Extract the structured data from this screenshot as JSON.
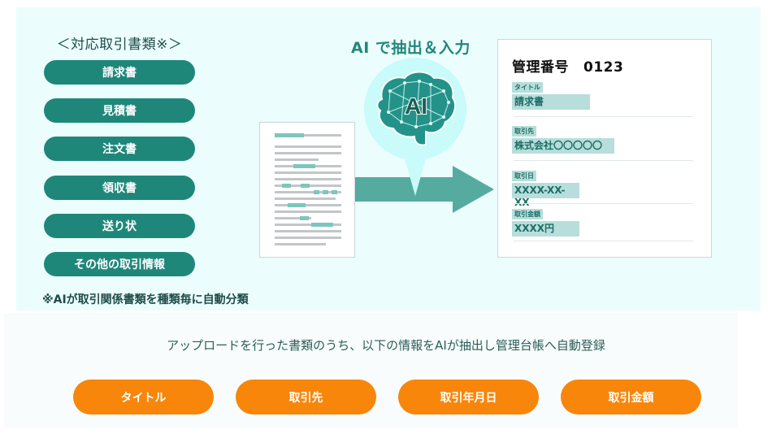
{
  "supported_types": {
    "heading": "＜対応取引書類※＞",
    "items": [
      "請求書",
      "見積書",
      "注文書",
      "領収書",
      "送り状",
      "その他の取引情報"
    ],
    "note": "※AIが取引関係書類を種類毎に自動分類"
  },
  "process": {
    "heading": "AI で抽出＆入力",
    "ai_badge_text": "AI",
    "icons": [
      "document-icon",
      "ai-brain-icon",
      "arrow-right-icon"
    ]
  },
  "record_card": {
    "title_label": "管理番号",
    "title_number": "0123",
    "fields": [
      {
        "label": "タイトル",
        "value": "請求書"
      },
      {
        "label": "取引先",
        "value": "株式会社〇〇〇〇〇"
      },
      {
        "label": "取引日",
        "value": "XXXX-XX-XX"
      },
      {
        "label": "取引金額",
        "value": "XXXX円"
      }
    ]
  },
  "extraction": {
    "description": "アップロードを行った書類のうち、以下の情報をAIが抽出し管理台帳へ自動登録",
    "items": [
      "タイトル",
      "取引先",
      "取引年月日",
      "取引金額"
    ]
  },
  "colors": {
    "teal": "#1f877a",
    "arrow_teal": "#56aba1",
    "orange": "#f7860b",
    "panel_bg": "#ebfefd",
    "highlight": "#b7dedb"
  }
}
